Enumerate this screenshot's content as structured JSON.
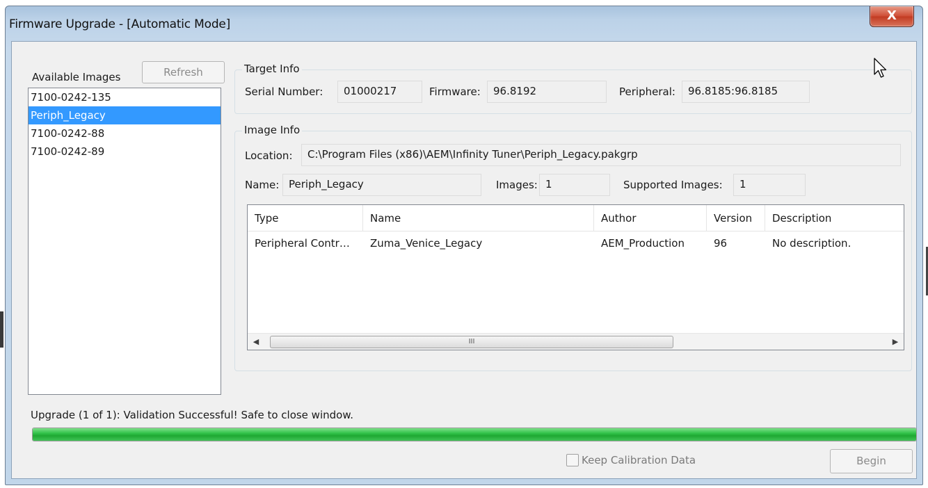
{
  "window": {
    "title": "Firmware Upgrade - [Automatic Mode]",
    "close_glyph": "X"
  },
  "images_panel": {
    "label": "Available Images",
    "refresh_label": "Refresh",
    "items": [
      "7100-0242-135",
      "Periph_Legacy",
      "7100-0242-88",
      "7100-0242-89"
    ],
    "selected_index": 1
  },
  "target_info": {
    "title": "Target Info",
    "serial_label": "Serial Number:",
    "serial_value": "01000217",
    "firmware_label": "Firmware:",
    "firmware_value": "96.8192",
    "peripheral_label": "Peripheral:",
    "peripheral_value": "96.8185:96.8185"
  },
  "image_info": {
    "title": "Image Info",
    "location_label": "Location:",
    "location_value": "C:\\Program Files (x86)\\AEM\\Infinity Tuner\\Periph_Legacy.pakgrp",
    "name_label": "Name:",
    "name_value": "Periph_Legacy",
    "images_label": "Images:",
    "images_value": "1",
    "supported_label": "Supported Images:",
    "supported_value": "1"
  },
  "table": {
    "columns": [
      "Type",
      "Name",
      "Author",
      "Version",
      "Description"
    ],
    "rows": [
      [
        "Peripheral Contr…",
        "Zuma_Venice_Legacy",
        "AEM_Production",
        "96",
        "No description."
      ]
    ],
    "scroll_left_glyph": "◀",
    "scroll_right_glyph": "▶",
    "thumb_grip": "III"
  },
  "status": {
    "text": "Upgrade (1 of 1): Validation Successful!  Safe to close window.",
    "progress_percent": 100,
    "progress_color": "#2db845"
  },
  "footer": {
    "keep_label": "Keep Calibration Data",
    "keep_checked": false,
    "begin_label": "Begin"
  }
}
